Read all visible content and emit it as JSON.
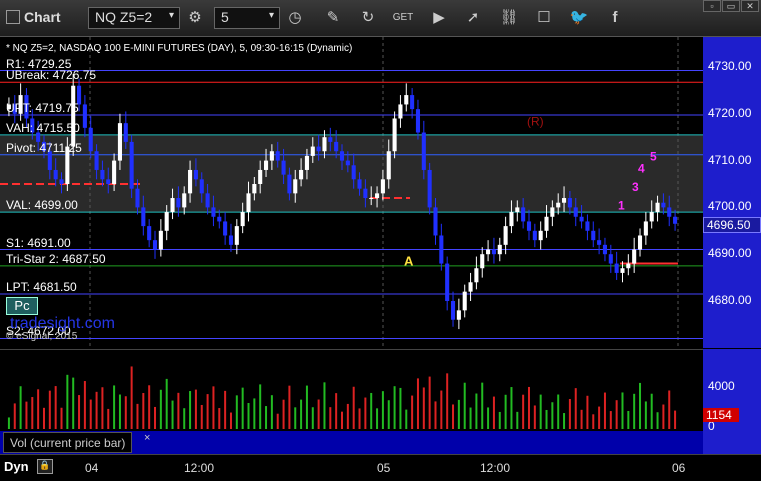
{
  "toolbar": {
    "title": "Chart",
    "symbol": "NQ Z5=2",
    "interval": "5",
    "icons": [
      "settings-icon",
      "clock-icon",
      "pen-icon",
      "refresh-icon",
      "get-icon",
      "play-icon",
      "cursor-icon",
      "link-icon",
      "comment-icon",
      "twitter-icon",
      "facebook-icon"
    ],
    "window_buttons": [
      "▫",
      "▭",
      "✕"
    ]
  },
  "chart": {
    "header": "* NQ Z5=2, NASDAQ 100 E-MINI FUTURES (DAY), 5, 09:30-16:15 (Dynamic)",
    "levels": [
      {
        "label": "R1: 4729.25",
        "price": 4729.25,
        "color": "#4444ff"
      },
      {
        "label": "UBreak: 4726.75",
        "price": 4726.75,
        "color": "#ff2020"
      },
      {
        "label": "UPT: 4719.75",
        "price": 4719.75,
        "color": "#4444ff"
      },
      {
        "label": "VAH: 4715.50",
        "price": 4715.5,
        "color": "#20c0c0"
      },
      {
        "label": "Pivot: 4711.25",
        "price": 4711.25,
        "color": "#3060ff"
      },
      {
        "label": "VAL: 4699.00",
        "price": 4699.0,
        "color": "#20c0c0"
      },
      {
        "label": "S1: 4691.00",
        "price": 4691.0,
        "color": "#4444ff"
      },
      {
        "label": "Tri-Star 2: 4687.50",
        "price": 4687.5,
        "color": "#20a020"
      },
      {
        "label": "LPT: 4681.50",
        "price": 4681.5,
        "color": "#4444ff"
      },
      {
        "label": "S2: 4672.00",
        "price": 4672.0,
        "color": "#4444ff"
      }
    ],
    "pc_button": "Pc",
    "watermark": "tradesight.com",
    "copyright": "© eSignal, 2015",
    "y_ticks": [
      "4730.00",
      "4720.00",
      "4710.00",
      "4700.00",
      "4690.00",
      "4680.00"
    ],
    "y_tick_values": [
      4730,
      4720,
      4710,
      4700,
      4690,
      4680
    ],
    "last_price": "4696.50",
    "marker_A": "A",
    "marker_R": "(R)",
    "magenta_count": [
      "1",
      "3",
      "4",
      "5"
    ]
  },
  "volume": {
    "label": "Vol (current price bar)",
    "close": "×",
    "y_tick": "4000",
    "y_tick_zero": "0",
    "last_value": "1154"
  },
  "xaxis": {
    "dyn": "Dyn",
    "lock": "🔒",
    "labels": [
      "04",
      "12:00",
      "05",
      "12:00",
      "06"
    ]
  },
  "chart_data": {
    "type": "candlestick",
    "title": "* NQ Z5=2, NASDAQ 100 E-MINI FUTURES (DAY), 5, 09:30-16:15 (Dynamic)",
    "x_labels": [
      "04",
      "12:00",
      "05",
      "12:00",
      "06"
    ],
    "ylim": [
      4667,
      4735
    ],
    "y_ticks": [
      4730,
      4720,
      4710,
      4700,
      4690,
      4680
    ],
    "last": 4696.5,
    "closes": [
      4722,
      4720,
      4724,
      4719,
      4716,
      4714,
      4712,
      4708,
      4706,
      4705,
      4713,
      4726,
      4722,
      4717,
      4712,
      4708,
      4706,
      4705,
      4710,
      4718,
      4714,
      4704,
      4700,
      4696,
      4693,
      4691,
      4695,
      4699,
      4702,
      4700,
      4703,
      4708,
      4706,
      4703,
      4700,
      4698,
      4697,
      4694,
      4692,
      4696,
      4699,
      4703,
      4705,
      4708,
      4710,
      4712,
      4710,
      4707,
      4703,
      4706,
      4708,
      4711,
      4713,
      4712,
      4715,
      4714,
      4712,
      4710,
      4709,
      4706,
      4704,
      4702,
      4702,
      4703,
      4706,
      4712,
      4719,
      4722,
      4724,
      4721,
      4716,
      4708,
      4700,
      4694,
      4688,
      4680,
      4676,
      4678,
      4682,
      4684,
      4687,
      4690,
      4691,
      4690,
      4692,
      4696,
      4699,
      4700,
      4697,
      4695,
      4693,
      4695,
      4698,
      4700,
      4701,
      4702,
      4700,
      4698,
      4697,
      4695,
      4693,
      4692,
      4690,
      4688,
      4686,
      4687,
      4688,
      4691,
      4694,
      4697,
      4699,
      4701,
      4700,
      4698,
      4696.5
    ],
    "volume_max": 4000
  }
}
